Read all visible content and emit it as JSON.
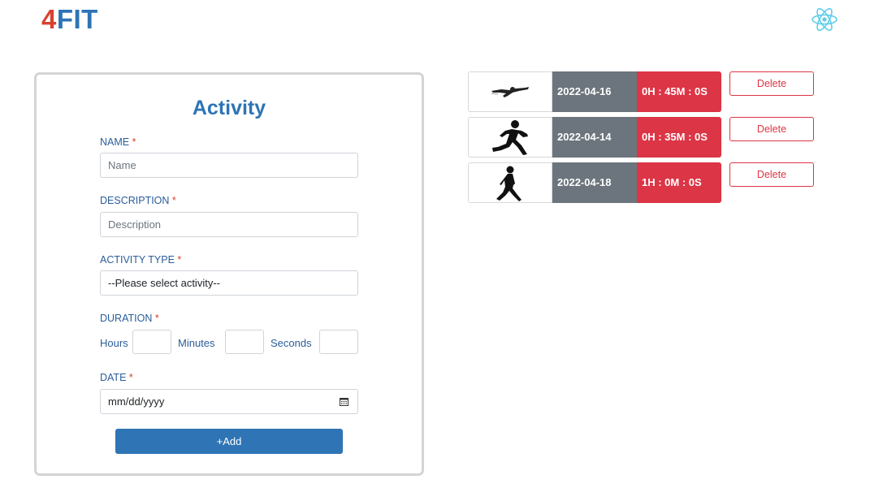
{
  "header": {
    "logo_prefix": "4",
    "logo_suffix": "FIT",
    "icon": "react-atom-icon"
  },
  "form": {
    "title": "Activity",
    "name_label": "NAME",
    "name_placeholder": "Name",
    "description_label": "DESCRIPTION",
    "description_placeholder": "Description",
    "activity_type_label": "ACTIVITY TYPE",
    "activity_type_selected": "--Please select activity--",
    "duration_label": "DURATION",
    "hours_label": "Hours",
    "minutes_label": "Minutes",
    "seconds_label": "Seconds",
    "date_label": "DATE",
    "date_placeholder": "mm/dd/yyyy",
    "required_mark": "*",
    "add_button": "+Add"
  },
  "activities": [
    {
      "icon": "swimmer-icon",
      "date": "2022-04-16",
      "duration": "0H : 45M : 0S",
      "delete_label": "Delete"
    },
    {
      "icon": "runner-icon",
      "date": "2022-04-14",
      "duration": "0H : 35M : 0S",
      "delete_label": "Delete"
    },
    {
      "icon": "walker-icon",
      "date": "2022-04-18",
      "duration": "1H : 0M : 0S",
      "delete_label": "Delete"
    }
  ],
  "colors": {
    "brand_red": "#d9412f",
    "brand_blue": "#2d74b5",
    "date_bg": "#6c757d",
    "duration_bg": "#dc3545"
  }
}
